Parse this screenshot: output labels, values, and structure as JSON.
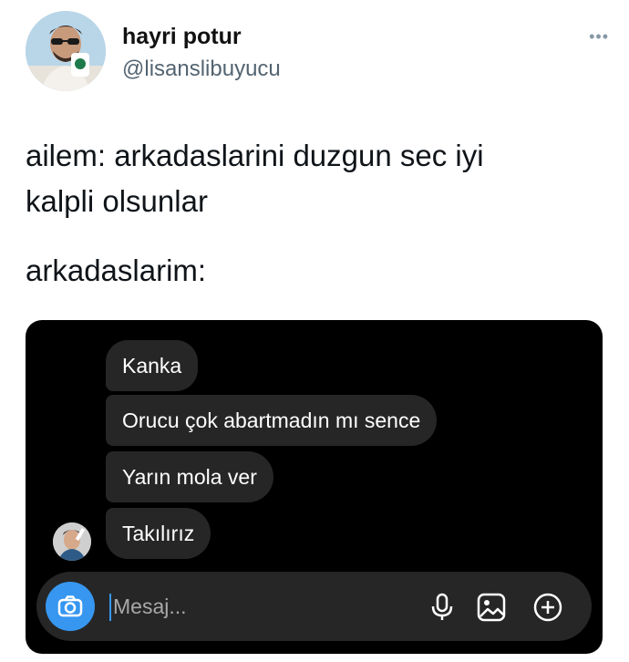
{
  "author": {
    "name": "hayri potur",
    "handle": "@lisanslibuyucu",
    "more_label": "•••"
  },
  "tweet": {
    "line1": "ailem: arkadaslarini duzgun sec iyi",
    "line2": "kalpli olsunlar",
    "line3": "arkadaslarim:"
  },
  "dm": {
    "messages": [
      {
        "text": "Kanka"
      },
      {
        "text": "Orucu çok abartmadın mı sence"
      },
      {
        "text": "Yarın mola ver"
      },
      {
        "text": "Takılırız"
      }
    ],
    "composer": {
      "placeholder": "Mesaj...",
      "camera_icon": "camera-icon",
      "mic_icon": "microphone-icon",
      "gallery_icon": "image-icon",
      "plus_icon": "plus-circle-icon"
    },
    "colors": {
      "background": "#000000",
      "bubble": "#262626",
      "accent": "#3797f0"
    }
  }
}
